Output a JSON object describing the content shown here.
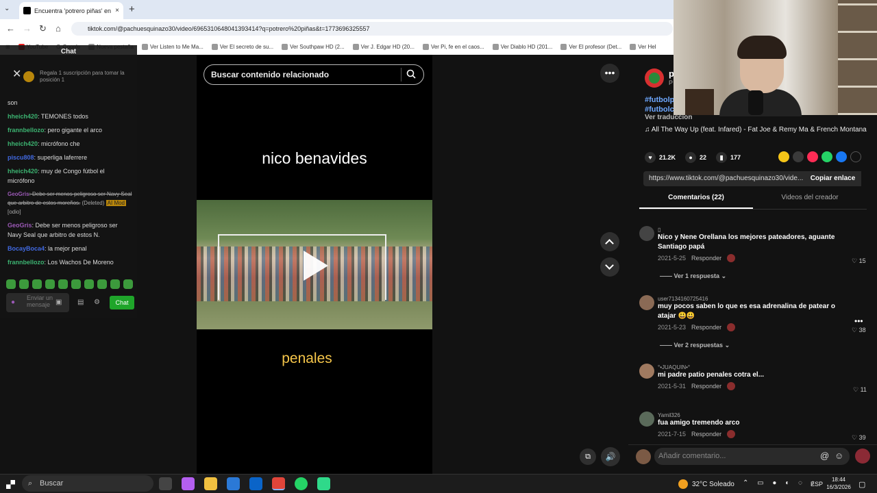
{
  "browser": {
    "tab_title": "Encuentra 'potrero piñas' en Ti",
    "tab_close": "×",
    "new_tab": "+",
    "url": "tiktok.com/@pachuesquinazo30/video/6965310648041393414?q=potrero%20piñas&t=1773696325557",
    "bookmarks": [
      "YouTube",
      "Google",
      "Nueva pestaña",
      "Ver Listen to Me Ma...",
      "Ver El secreto de su...",
      "Ver Southpaw HD (2...",
      "Ver J. Edgar HD (20...",
      "Ver Pi, fe en el caos...",
      "Ver Diablo HD (201...",
      "Ver El profesor (Det...",
      "Ver Hel"
    ]
  },
  "chat": {
    "title": "Chat",
    "close": "✕",
    "subscription_prompt": "Regala 1 suscripción para tomar la posición 1",
    "messages": [
      {
        "user": "",
        "text": "son",
        "color": "#dddddd"
      },
      {
        "user": "hheich420",
        "text": ": TEMONES todos",
        "color": "#3cb371"
      },
      {
        "user": "frannbellozo",
        "text": ": pero gigante el arco",
        "color": "#3cb371"
      },
      {
        "user": "hheich420",
        "text": ": micrófono che",
        "color": "#3cb371"
      },
      {
        "user": "piscu808",
        "text": ": superliga laferrere",
        "color": "#4169e1"
      },
      {
        "user": "hheich420",
        "text": ": muy de Congo fútbol el micrófono",
        "color": "#3cb371"
      },
      {
        "user": "GeoGris",
        "text": ": Debe ser menos peligroso ser Navy Seal que arbitro de estos moreños.",
        "color": "#9b59b6",
        "deleted": true,
        "tag": "(Deleted)",
        "tag2": "AI Mod",
        "tag3": "[odio]"
      },
      {
        "user": "GeoGris",
        "text": ": Debe ser menos peligroso ser Navy Seal que arbitro de estos N.",
        "color": "#9b59b6"
      },
      {
        "user": "BocayBoca4",
        "text": ": la mejor penal",
        "color": "#4169e1"
      },
      {
        "user": "frannbellozo",
        "text": ": Los Wachos De Moreno",
        "color": "#3cb371"
      }
    ],
    "input_placeholder": "Enviar un mensaje",
    "send_label": "Chat"
  },
  "video": {
    "search_placeholder": "Buscar contenido relacionado",
    "caption_top": "nico benavides",
    "caption_bottom": "penales",
    "more": "•••"
  },
  "post": {
    "author_initial": "p",
    "author_sub": "P",
    "tags": [
      "#futbolp",
      "#futbolc"
    ],
    "translate": "Ver traducción",
    "music": "♫  All The Way Up (feat. Infared) - Fat Joe & Remy Ma & French Montana",
    "likes": "21.2K",
    "comments": "22",
    "saves": "177",
    "link": "https://www.tiktok.com/@pachuesquinazo30/vide...",
    "copy_label": "Copiar enlace",
    "share_colors": [
      "#f5c518",
      "#3a3a3a",
      "#fe2c55",
      "#25d366",
      "#1877f2",
      "#121212"
    ]
  },
  "tabs": {
    "comments": "Comentarios (22)",
    "videos": "Videos del creador"
  },
  "comments": [
    {
      "user": "▯",
      "text": "Nico y Nene Orellana los mejores pateadores, aguante Santiago papá",
      "date": "2021-5-25",
      "reply": "Responder",
      "likes": "15",
      "replies": "Ver 1 respuesta"
    },
    {
      "user": "user7134160725416",
      "text": "muy pocos saben lo que es esa adrenalina de patear o atajar 😃😃",
      "date": "2021-5-23",
      "reply": "Responder",
      "likes": "38",
      "replies": "Ver 2 respuestas"
    },
    {
      "user": "°•JUAQUIN•°",
      "text": "mi padre patio penales cotra el...",
      "date": "2021-5-31",
      "reply": "Responder",
      "likes": "11"
    },
    {
      "user": "Yamil326",
      "text": "fua amigo tremendo arco",
      "date": "2021-7-15",
      "reply": "Responder",
      "likes": "39"
    }
  ],
  "comment_bar": {
    "placeholder": "Añadir comentario..."
  },
  "taskbar": {
    "search": "Buscar",
    "weather": "32°C  Soleado",
    "lang": "ESP",
    "time": "18:44",
    "date": "16/3/2026"
  }
}
